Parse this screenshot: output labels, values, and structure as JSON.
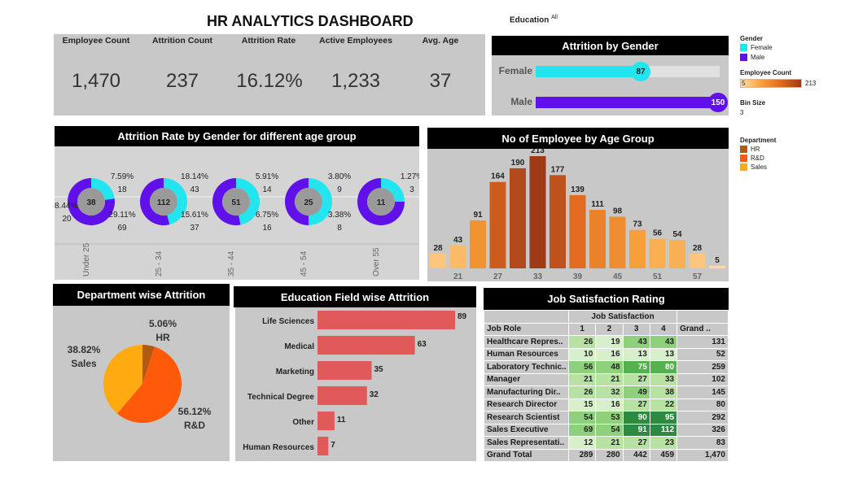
{
  "title": "HR ANALYTICS DASHBOARD",
  "filter": {
    "label": "Education",
    "value": "All"
  },
  "kpis": [
    {
      "label": "Employee Count",
      "value": "1,470"
    },
    {
      "label": "Attrition Count",
      "value": "237"
    },
    {
      "label": "Attrition Rate",
      "value": "16.12%"
    },
    {
      "label": "Active Employees",
      "value": "1,233"
    },
    {
      "label": "Avg. Age",
      "value": "37"
    }
  ],
  "gender_chart": {
    "title": "Attrition by Gender",
    "rows": [
      {
        "label": "Female",
        "value": 87,
        "color": "#22e5f0"
      },
      {
        "label": "Male",
        "value": 150,
        "color": "#6010e8"
      }
    ],
    "max": 150
  },
  "legend": {
    "gender_title": "Gender",
    "gender_items": [
      {
        "label": "Female",
        "color": "#22e5f0"
      },
      {
        "label": "Male",
        "color": "#6010e8"
      }
    ],
    "count_title": "Employee Count",
    "count_min": "5",
    "count_max": "213",
    "bin_title": "Bin Size",
    "bin_value": "3",
    "dept_title": "Department",
    "dept_items": [
      {
        "label": "HR",
        "color": "#b15a10"
      },
      {
        "label": "R&D",
        "color": "#ff5a0a"
      },
      {
        "label": "Sales",
        "color": "#ffaa10"
      }
    ]
  },
  "age_gender_chart": {
    "title": "Attrition Rate by Gender for different age group",
    "groups": [
      {
        "label": "Under 25",
        "center": "38",
        "female_pct": "7.59%",
        "female_n": "18",
        "male_pct": "29.11%",
        "male_n": "69",
        "extra_pct": "8.44%",
        "extra_n": "20",
        "female_share": 0.23
      },
      {
        "label": "25 - 34",
        "center": "112",
        "female_pct": "18.14%",
        "female_n": "43",
        "male_pct": "15.61%",
        "male_n": "37",
        "female_share": 0.46
      },
      {
        "label": "35 - 44",
        "center": "51",
        "female_pct": "5.91%",
        "female_n": "14",
        "male_pct": "6.75%",
        "male_n": "16",
        "female_share": 0.47
      },
      {
        "label": "45 - 54",
        "center": "25",
        "female_pct": "3.80%",
        "female_n": "9",
        "male_pct": "3.38%",
        "male_n": "8",
        "female_share": 0.5
      },
      {
        "label": "Over 55",
        "center": "11",
        "female_pct": "1.27%",
        "female_n": "3",
        "male_pct": "",
        "male_n": "",
        "female_share": 0.25
      }
    ]
  },
  "chart_data": [
    {
      "type": "bar",
      "title": "No of Employee by Age Group",
      "x_tick_labels": [
        "21",
        "27",
        "33",
        "39",
        "45",
        "51",
        "57"
      ],
      "values": [
        28,
        43,
        91,
        164,
        190,
        213,
        177,
        139,
        111,
        98,
        73,
        56,
        54,
        28,
        5
      ],
      "ylim": [
        0,
        213
      ]
    },
    {
      "type": "bar",
      "title": "Education Field wise Attrition",
      "categories": [
        "Life Sciences",
        "Medical",
        "Marketing",
        "Technical Degree",
        "Other",
        "Human Resources"
      ],
      "values": [
        89,
        63,
        35,
        32,
        11,
        7
      ]
    },
    {
      "type": "pie",
      "title": "Department wise Attrition",
      "slices": [
        {
          "name": "HR",
          "pct": "5.06%",
          "value": 5.06,
          "color": "#b15a10"
        },
        {
          "name": "R&D",
          "pct": "56.12%",
          "value": 56.12,
          "color": "#ff5a0a"
        },
        {
          "name": "Sales",
          "pct": "38.82%",
          "value": 38.82,
          "color": "#ffaa10"
        }
      ]
    },
    {
      "type": "table",
      "title": "Job Satisfaction Rating",
      "group_header": "Job Satisfaction",
      "row_header": "Job Role",
      "columns": [
        "1",
        "2",
        "3",
        "4",
        "Grand .."
      ],
      "rows": [
        {
          "role": "Healthcare Repres..",
          "values": [
            "26",
            "19",
            "43",
            "43",
            "131"
          ]
        },
        {
          "role": "Human Resources",
          "values": [
            "10",
            "16",
            "13",
            "13",
            "52"
          ]
        },
        {
          "role": "Laboratory Technic..",
          "values": [
            "56",
            "48",
            "75",
            "80",
            "259"
          ]
        },
        {
          "role": "Manager",
          "values": [
            "21",
            "21",
            "27",
            "33",
            "102"
          ]
        },
        {
          "role": "Manufacturing Dir..",
          "values": [
            "26",
            "32",
            "49",
            "38",
            "145"
          ]
        },
        {
          "role": "Research Director",
          "values": [
            "15",
            "16",
            "27",
            "22",
            "80"
          ]
        },
        {
          "role": "Research Scientist",
          "values": [
            "54",
            "53",
            "90",
            "95",
            "292"
          ]
        },
        {
          "role": "Sales Executive",
          "values": [
            "69",
            "54",
            "91",
            "112",
            "326"
          ]
        },
        {
          "role": "Sales Representati..",
          "values": [
            "12",
            "21",
            "27",
            "23",
            "83"
          ]
        }
      ],
      "total_row": {
        "role": "Grand Total",
        "values": [
          "289",
          "280",
          "442",
          "459",
          "1,470"
        ]
      }
    }
  ]
}
